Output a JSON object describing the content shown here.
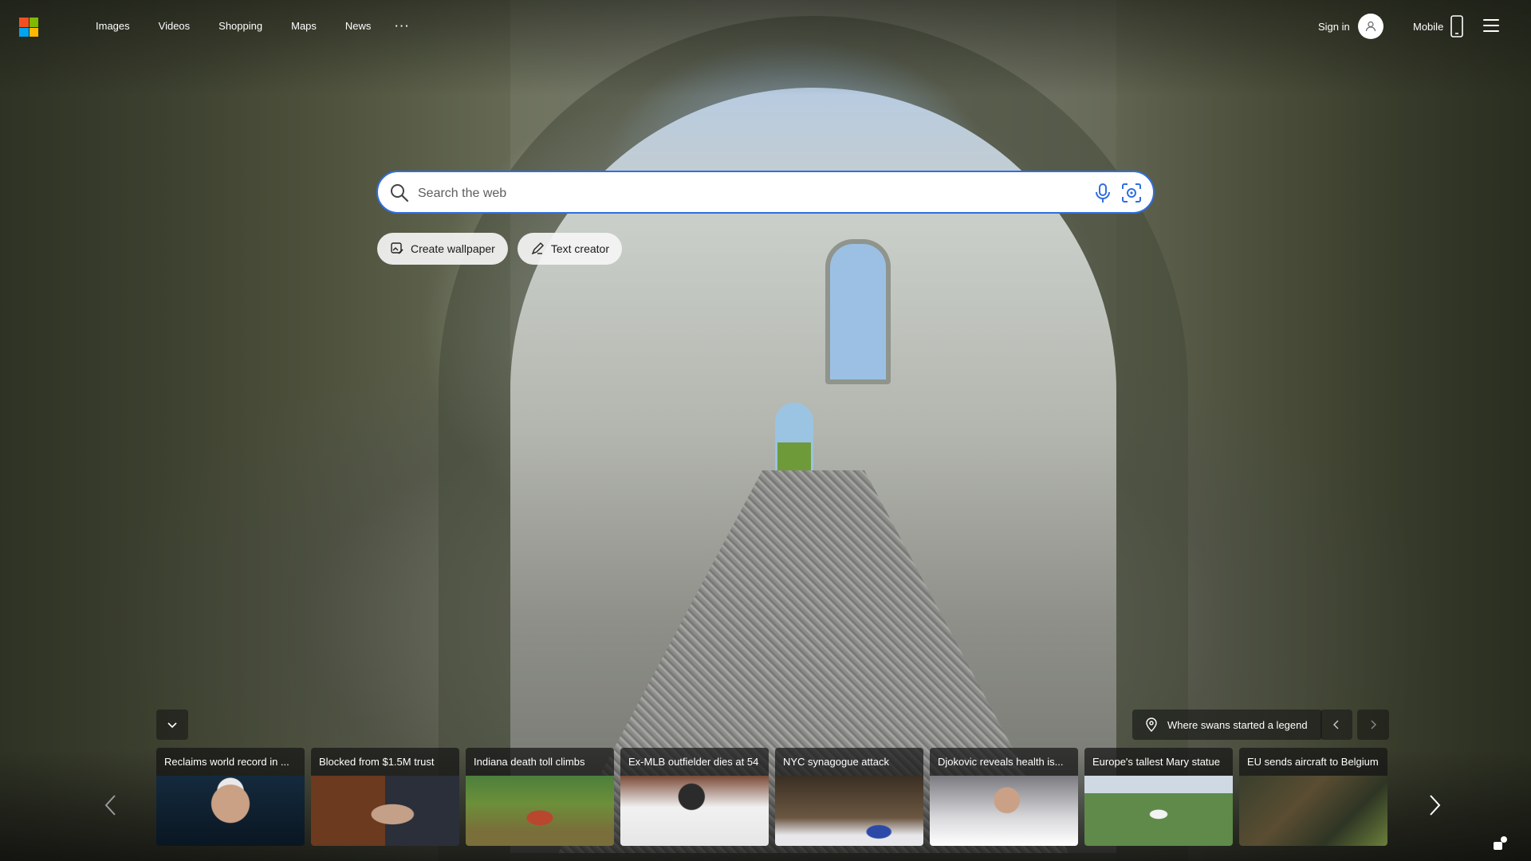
{
  "header": {
    "nav": [
      "Images",
      "Videos",
      "Shopping",
      "Maps",
      "News"
    ],
    "more_label": "···",
    "sign_in_label": "Sign in",
    "mobile_label": "Mobile"
  },
  "logo": {
    "colors": [
      "#f25022",
      "#7fba00",
      "#00a4ef",
      "#ffb900"
    ]
  },
  "search": {
    "placeholder": "Search the web",
    "value": "",
    "accent_color": "#2f6ee0"
  },
  "chips": {
    "create_wallpaper": "Create wallpaper",
    "text_creator": "Text creator"
  },
  "image_info": {
    "location_label": "Where swans started a legend"
  },
  "news_cards": [
    {
      "title": "Reclaims world record in ...",
      "image": "swimmer"
    },
    {
      "title": "Blocked from $1.5M trust",
      "image": "courtroom"
    },
    {
      "title": "Indiana death toll climbs",
      "image": "flood-aerial"
    },
    {
      "title": "Ex-MLB outfielder dies at 54",
      "image": "baseball-players"
    },
    {
      "title": "NYC synagogue attack",
      "image": "police-car-synagogue"
    },
    {
      "title": "Djokovic reveals health is...",
      "image": "tennis-player"
    },
    {
      "title": "Europe's tallest Mary statue",
      "image": "statue-aerial"
    },
    {
      "title": "EU sends aircraft to Belgium",
      "image": "crash-debris"
    }
  ]
}
